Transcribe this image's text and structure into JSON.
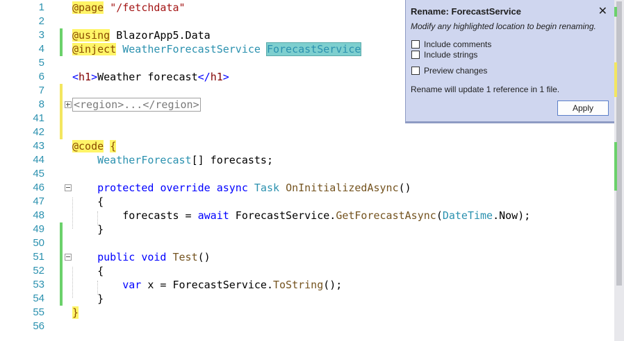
{
  "editor": {
    "lines": [
      {
        "num": "1",
        "tokens": [
          {
            "t": "@page",
            "c": "dir"
          },
          {
            "t": " ",
            "c": ""
          },
          {
            "t": "\"/fetchdata\"",
            "c": "str"
          }
        ]
      },
      {
        "num": "2",
        "tokens": []
      },
      {
        "num": "3",
        "tokens": [
          {
            "t": "@using",
            "c": "dir"
          },
          {
            "t": " BlazorApp5.Data",
            "c": ""
          }
        ]
      },
      {
        "num": "4",
        "tokens": [
          {
            "t": "@inject",
            "c": "dir"
          },
          {
            "t": " ",
            "c": ""
          },
          {
            "t": "WeatherForecastService",
            "c": "typ"
          },
          {
            "t": " ",
            "c": ""
          },
          {
            "t": "ForecastService",
            "c": "rename-hl typ"
          }
        ]
      },
      {
        "num": "5",
        "tokens": []
      },
      {
        "num": "6",
        "tokens": [
          {
            "t": "<",
            "c": "kw"
          },
          {
            "t": "h1",
            "c": "tag"
          },
          {
            "t": ">",
            "c": "kw"
          },
          {
            "t": "Weather forecast",
            "c": ""
          },
          {
            "t": "</",
            "c": "kw"
          },
          {
            "t": "h1",
            "c": "tag"
          },
          {
            "t": ">",
            "c": "kw"
          }
        ]
      },
      {
        "num": "7",
        "tokens": []
      },
      {
        "num": "8",
        "tokens": [
          {
            "t": "<region>...</region>",
            "c": "region-box"
          }
        ]
      },
      {
        "num": "41",
        "tokens": []
      },
      {
        "num": "42",
        "tokens": []
      },
      {
        "num": "43",
        "tokens": [
          {
            "t": "@code",
            "c": "dir"
          },
          {
            "t": " ",
            "c": ""
          },
          {
            "t": "{",
            "c": "dir"
          }
        ]
      },
      {
        "num": "44",
        "tokens": [
          {
            "t": "    ",
            "c": ""
          },
          {
            "t": "WeatherForecast",
            "c": "typ"
          },
          {
            "t": "[] forecasts;",
            "c": ""
          }
        ]
      },
      {
        "num": "45",
        "tokens": []
      },
      {
        "num": "46",
        "tokens": [
          {
            "t": "    ",
            "c": ""
          },
          {
            "t": "protected",
            "c": "kw"
          },
          {
            "t": " ",
            "c": ""
          },
          {
            "t": "override",
            "c": "kw"
          },
          {
            "t": " ",
            "c": ""
          },
          {
            "t": "async",
            "c": "kw"
          },
          {
            "t": " ",
            "c": ""
          },
          {
            "t": "Task",
            "c": "typ"
          },
          {
            "t": " ",
            "c": ""
          },
          {
            "t": "OnInitializedAsync",
            "c": "meth"
          },
          {
            "t": "()",
            "c": ""
          }
        ]
      },
      {
        "num": "47",
        "tokens": [
          {
            "t": "    {",
            "c": ""
          }
        ]
      },
      {
        "num": "48",
        "tokens": [
          {
            "t": "        forecasts = ",
            "c": ""
          },
          {
            "t": "await",
            "c": "kw"
          },
          {
            "t": " ForecastService.",
            "c": ""
          },
          {
            "t": "GetForecastAsync",
            "c": "meth"
          },
          {
            "t": "(",
            "c": ""
          },
          {
            "t": "DateTime",
            "c": "typ"
          },
          {
            "t": ".Now);",
            "c": ""
          }
        ]
      },
      {
        "num": "49",
        "tokens": [
          {
            "t": "    }",
            "c": ""
          }
        ]
      },
      {
        "num": "50",
        "tokens": []
      },
      {
        "num": "51",
        "tokens": [
          {
            "t": "    ",
            "c": ""
          },
          {
            "t": "public",
            "c": "kw"
          },
          {
            "t": " ",
            "c": ""
          },
          {
            "t": "void",
            "c": "kw"
          },
          {
            "t": " ",
            "c": ""
          },
          {
            "t": "Test",
            "c": "meth"
          },
          {
            "t": "()",
            "c": ""
          }
        ]
      },
      {
        "num": "52",
        "tokens": [
          {
            "t": "    {",
            "c": ""
          }
        ]
      },
      {
        "num": "53",
        "tokens": [
          {
            "t": "        ",
            "c": ""
          },
          {
            "t": "var",
            "c": "kw"
          },
          {
            "t": " x = ForecastService.",
            "c": ""
          },
          {
            "t": "ToString",
            "c": "meth"
          },
          {
            "t": "();",
            "c": ""
          }
        ]
      },
      {
        "num": "54",
        "tokens": [
          {
            "t": "    }",
            "c": ""
          }
        ]
      },
      {
        "num": "55",
        "tokens": [
          {
            "t": "}",
            "c": "dir"
          }
        ]
      },
      {
        "num": "56",
        "tokens": []
      }
    ]
  },
  "rename_dialog": {
    "title": "Rename: ForecastService",
    "close_glyph": "✕",
    "subtitle": "Modify any highlighted location to begin renaming.",
    "include_comments_label": "Include comments",
    "include_strings_label": "Include strings",
    "preview_changes_label": "Preview changes",
    "info": "Rename will update 1 reference in 1 file.",
    "apply_label": "Apply",
    "accent_color": "#cfd6ef"
  }
}
